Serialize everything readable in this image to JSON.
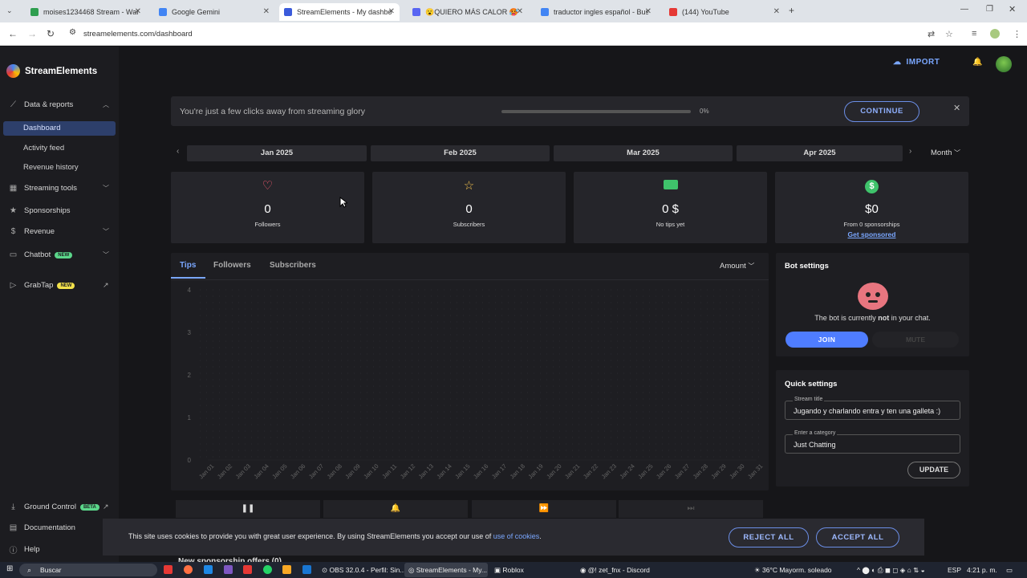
{
  "browser": {
    "tabs": [
      {
        "title": "moises1234468 Stream - Watch",
        "color": "#2e9e4f"
      },
      {
        "title": "Google Gemini",
        "color": "#4285f4"
      },
      {
        "title": "StreamElements - My dashboard",
        "color": "#3b5bdb"
      },
      {
        "title": "😮QUIERO MÁS CALOR 🥵 | El a",
        "color": "#5865f2"
      },
      {
        "title": "traductor ingles español - Busc",
        "color": "#4285f4"
      },
      {
        "title": "(144) YouTube",
        "color": "#e53935"
      }
    ],
    "url": "streamelements.com/dashboard"
  },
  "brand": {
    "name": "StreamElements"
  },
  "header": {
    "import_label": "IMPORT"
  },
  "sidebar": {
    "data_reports": "Data & reports",
    "sub": [
      "Dashboard",
      "Activity feed",
      "Revenue history"
    ],
    "streaming_tools": "Streaming tools",
    "sponsorships": "Sponsorships",
    "revenue": "Revenue",
    "chatbot": "Chatbot",
    "chatbot_badge": "NEW",
    "grabtap": "GrabTap",
    "grabtap_badge": "NEW",
    "ground_control": "Ground Control",
    "ground_badge": "BETA",
    "documentation": "Documentation",
    "help": "Help"
  },
  "banner": {
    "text": "You're just a few clicks away from streaming glory",
    "progress_value": 0,
    "progress": "0%",
    "continue": "CONTINUE"
  },
  "periods": {
    "months": [
      "Jan 2025",
      "Feb 2025",
      "Mar 2025",
      "Apr 2025"
    ],
    "selector": "Month"
  },
  "stats": [
    {
      "value": "0",
      "label": "Followers",
      "icon": "heart-icon"
    },
    {
      "value": "0",
      "label": "Subscribers",
      "icon": "star-icon"
    },
    {
      "value": "0 $",
      "label": "No tips yet",
      "icon": "cash-icon"
    },
    {
      "value": "$0",
      "label": "From 0 sponsorships",
      "link": "Get sponsored",
      "icon": "dollar-icon"
    }
  ],
  "chart_tabs": [
    "Tips",
    "Followers",
    "Subscribers"
  ],
  "chart_selector": "Amount",
  "chart_data": {
    "type": "line",
    "categories": [
      "Jan 01",
      "Jan 02",
      "Jan 03",
      "Jan 04",
      "Jan 05",
      "Jan 06",
      "Jan 07",
      "Jan 08",
      "Jan 09",
      "Jan 10",
      "Jan 11",
      "Jan 12",
      "Jan 13",
      "Jan 14",
      "Jan 15",
      "Jan 16",
      "Jan 17",
      "Jan 18",
      "Jan 19",
      "Jan 20",
      "Jan 21",
      "Jan 22",
      "Jan 23",
      "Jan 24",
      "Jan 25",
      "Jan 26",
      "Jan 27",
      "Jan 28",
      "Jan 29",
      "Jan 30",
      "Jan 31"
    ],
    "yticks": [
      "0",
      "1",
      "2",
      "3",
      "4"
    ],
    "ylim": [
      0,
      4
    ],
    "series": [
      {
        "values": [
          0,
          0,
          0,
          0,
          0,
          0,
          0,
          0,
          0,
          0,
          0,
          0,
          0,
          0,
          0,
          0,
          0,
          0,
          0,
          0,
          0,
          0,
          0,
          0,
          0,
          0,
          0,
          0,
          0,
          0,
          0
        ]
      }
    ],
    "grid": true
  },
  "bot": {
    "title": "Bot settings",
    "msg_pre": "The bot is currently ",
    "msg_bold": "not",
    "msg_post": " in your chat.",
    "join": "JOIN",
    "mute": "MUTE"
  },
  "quick": {
    "title": "Quick settings",
    "stream_title_label": "Stream title",
    "stream_title_value": "Jugando y charlando entra y ten una galleta :)",
    "category_label": "Enter a category",
    "category_value": "Just Chatting",
    "update": "UPDATE"
  },
  "partial_text": "New sponsorship offers (0)",
  "cookie": {
    "text": "This site uses cookies to provide you with great user experience. By using StreamElements you accept our use of ",
    "link": "use of cookies",
    "end": ".",
    "reject": "REJECT ALL",
    "accept": "ACCEPT ALL"
  },
  "taskbar": {
    "search": "Buscar",
    "items": [
      "OBS 32.0.4 - Perfil: Sin...",
      "StreamElements - My...",
      "Roblox",
      "@! zet_fnx - Discord"
    ],
    "weather": "36°C  Mayorm. soleado",
    "lang": "ESP",
    "time": "4:21 p. m."
  }
}
